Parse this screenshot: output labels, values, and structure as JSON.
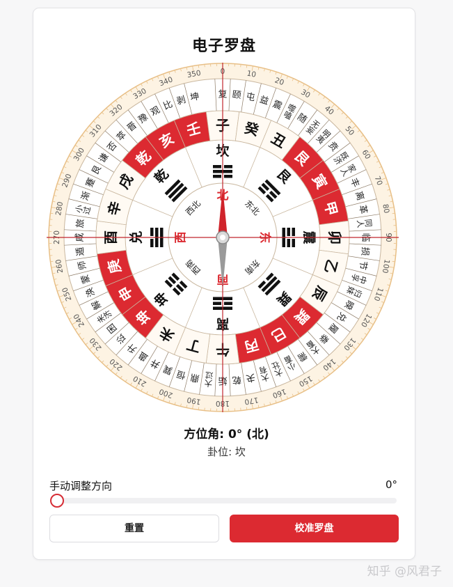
{
  "title": "电子罗盘",
  "colors": {
    "accent": "#dc2a31",
    "ring": "#fdf3e3",
    "ringBorder": "#e8bf86"
  },
  "compass": {
    "degree_labels": [
      "0",
      "10",
      "20",
      "30",
      "40",
      "50",
      "60",
      "70",
      "80",
      "90",
      "100",
      "110",
      "120",
      "130",
      "140",
      "150",
      "160",
      "170",
      "180",
      "190",
      "200",
      "210",
      "220",
      "230",
      "240",
      "250",
      "260",
      "270",
      "280",
      "290",
      "300",
      "310",
      "320",
      "330",
      "340",
      "350"
    ],
    "hexagrams": [
      "复",
      "颐",
      "屯",
      "益",
      "震",
      "噬嗑",
      "随",
      "无妄",
      "明夷",
      "贲",
      "既济",
      "家人",
      "丰",
      "离",
      "革",
      "同人",
      "临",
      "损",
      "节",
      "中孚",
      "归妹",
      "睽",
      "兑",
      "履",
      "泰",
      "大畜",
      "需",
      "小畜",
      "大壮",
      "大有",
      "夬",
      "乾",
      "姤",
      "大过",
      "鼎",
      "恒",
      "巽",
      "井",
      "蛊",
      "升",
      "讼",
      "困",
      "未济",
      "解",
      "涣",
      "蒙",
      "师",
      "遁",
      "咸",
      "旅",
      "小过",
      "渐",
      "蹇",
      "艮",
      "谦",
      "否",
      "萃",
      "晋",
      "豫",
      "观",
      "比",
      "剥",
      "坤"
    ],
    "mountains": [
      {
        "label": "子",
        "red": false
      },
      {
        "label": "癸",
        "red": false
      },
      {
        "label": "丑",
        "red": false
      },
      {
        "label": "艮",
        "red": true
      },
      {
        "label": "寅",
        "red": true
      },
      {
        "label": "甲",
        "red": true
      },
      {
        "label": "卯",
        "red": false
      },
      {
        "label": "乙",
        "red": false
      },
      {
        "label": "辰",
        "red": false
      },
      {
        "label": "巽",
        "red": true
      },
      {
        "label": "巳",
        "red": true
      },
      {
        "label": "丙",
        "red": true
      },
      {
        "label": "午",
        "red": false
      },
      {
        "label": "丁",
        "red": false
      },
      {
        "label": "未",
        "red": false
      },
      {
        "label": "坤",
        "red": true
      },
      {
        "label": "申",
        "red": true
      },
      {
        "label": "庚",
        "red": true
      },
      {
        "label": "酉",
        "red": false
      },
      {
        "label": "辛",
        "red": false
      },
      {
        "label": "戌",
        "red": false
      },
      {
        "label": "乾",
        "red": true
      },
      {
        "label": "亥",
        "red": true
      },
      {
        "label": "壬",
        "red": true
      }
    ],
    "trigrams": [
      {
        "name": "坎",
        "lines": [
          0,
          1,
          0
        ]
      },
      {
        "name": "艮",
        "lines": [
          1,
          0,
          0
        ]
      },
      {
        "name": "震",
        "lines": [
          0,
          0,
          1
        ]
      },
      {
        "name": "巽",
        "lines": [
          1,
          1,
          0
        ]
      },
      {
        "name": "离",
        "lines": [
          1,
          0,
          1
        ]
      },
      {
        "name": "坤",
        "lines": [
          0,
          0,
          0
        ]
      },
      {
        "name": "兑",
        "lines": [
          0,
          1,
          1
        ]
      },
      {
        "name": "乾",
        "lines": [
          1,
          1,
          1
        ]
      }
    ],
    "directions": [
      {
        "label": "北",
        "red": true
      },
      {
        "label": "东北",
        "red": false
      },
      {
        "label": "东",
        "red": true
      },
      {
        "label": "东南",
        "red": false
      },
      {
        "label": "南",
        "red": true
      },
      {
        "label": "西南",
        "red": false
      },
      {
        "label": "西",
        "red": true
      },
      {
        "label": "西北",
        "red": false
      }
    ],
    "needle_heading": 0
  },
  "azimuth_text": "方位角: 0° (北)",
  "gua_text": "卦位: 坎",
  "slider": {
    "label": "手动调整方向",
    "value_text": "0°",
    "value": 0
  },
  "buttons": {
    "reset": "重置",
    "calibrate": "校准罗盘"
  },
  "watermark": "知乎 @风君子"
}
